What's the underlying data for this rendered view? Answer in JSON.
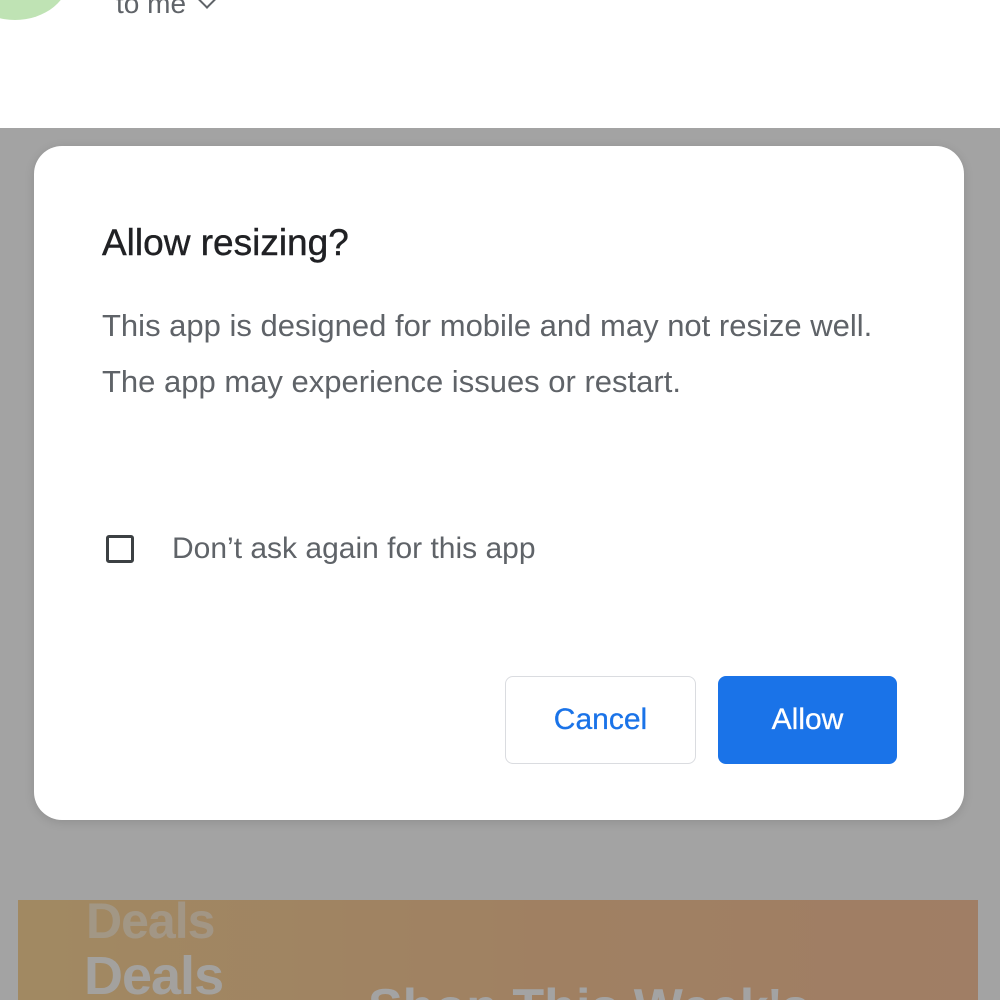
{
  "background": {
    "recipient_label": "to me",
    "promo": {
      "deals_ghost": "Deals",
      "deals": "Deals",
      "headline": "Shop This Week's"
    }
  },
  "dialog": {
    "title": "Allow resizing?",
    "body": "This app is designed for mobile and may not resize well. The app may experience issues or restart.",
    "checkbox": {
      "label": "Don’t ask again for this app",
      "checked": false
    },
    "cancel_label": "Cancel",
    "allow_label": "Allow"
  },
  "colors": {
    "accent": "#1a73e8",
    "scrim": "#a6a6a6",
    "text_primary": "#202124",
    "text_secondary": "#5f6368"
  },
  "icons": {
    "recipient_toggle": "chevron-down-icon",
    "checkbox": "checkbox-unchecked-icon"
  }
}
